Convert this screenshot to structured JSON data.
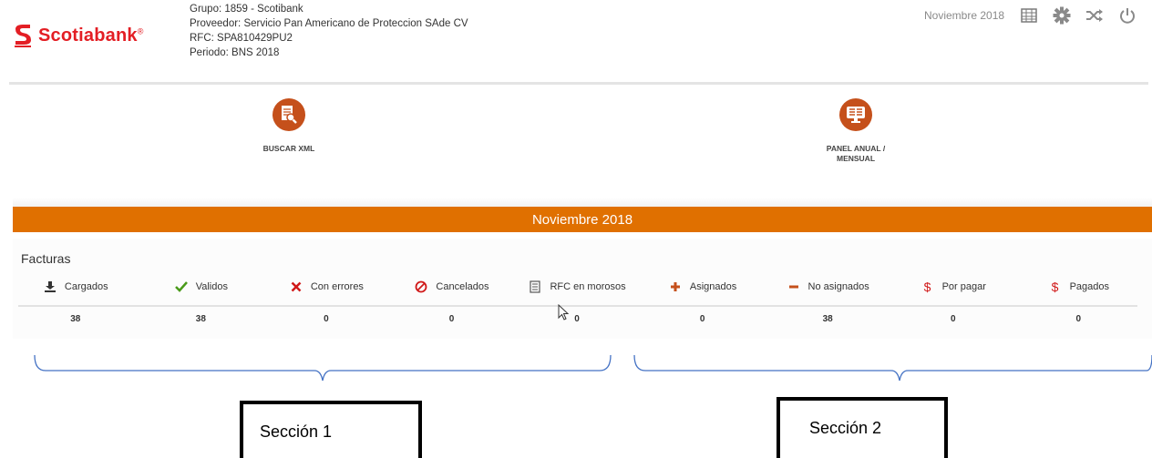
{
  "header": {
    "brand": "Scotiabank",
    "brand_mark": "®",
    "brand_color": "#e31e24",
    "grupo": "Grupo: 1859 - Scotibank",
    "proveedor": "Proveedor: Servicio Pan Americano de Proteccion SAde CV",
    "rfc": "RFC: SPA810429PU2",
    "periodo": "Periodo: BNS 2018",
    "current_month": "Noviembre 2018",
    "icons": [
      "calendar-icon",
      "gear-icon",
      "shuffle-icon",
      "power-icon"
    ]
  },
  "actions": {
    "buscar": "BUSCAR XML",
    "panel_line1": "PANEL ANUAL /",
    "panel_line2": "MENSUAL",
    "accent_color": "#c5501b"
  },
  "band": {
    "title": "Noviembre 2018",
    "color": "#e07000"
  },
  "facturas": {
    "title": "Facturas",
    "columns": [
      {
        "label": "Cargados",
        "value": "38",
        "icon": "upload-icon"
      },
      {
        "label": "Validos",
        "value": "38",
        "icon": "check-icon"
      },
      {
        "label": "Con errores",
        "value": "0",
        "icon": "x-icon"
      },
      {
        "label": "Cancelados",
        "value": "0",
        "icon": "ban-icon"
      },
      {
        "label": "RFC en morosos",
        "value": "0",
        "icon": "list-icon"
      },
      {
        "label": "Asignados",
        "value": "0",
        "icon": "plus-icon"
      },
      {
        "label": "No asignados",
        "value": "38",
        "icon": "minus-icon"
      },
      {
        "label": "Por pagar",
        "value": "0",
        "icon": "dollar-icon"
      },
      {
        "label": "Pagados",
        "value": "0",
        "icon": "dollar-icon"
      }
    ]
  },
  "annotations": {
    "section1": "Sección 1",
    "section2": "Sección 2"
  }
}
